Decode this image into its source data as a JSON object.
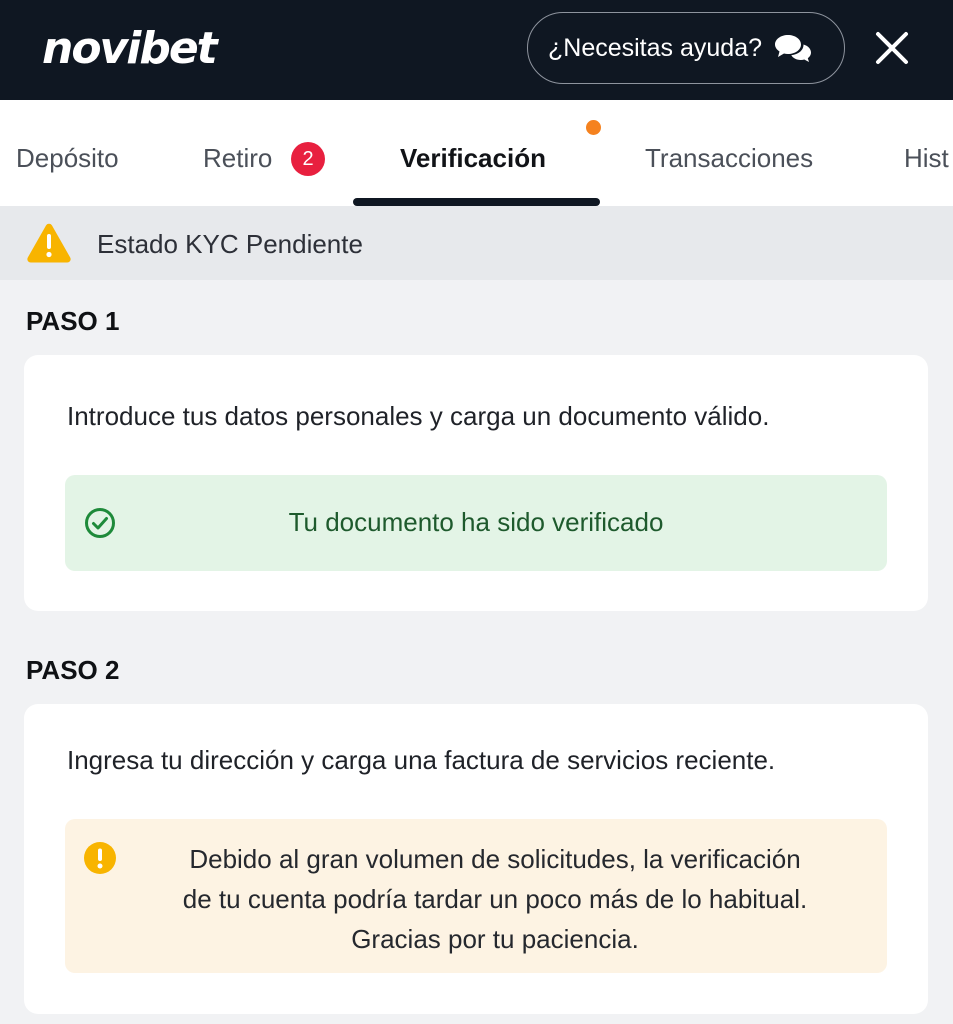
{
  "header": {
    "logo_text": "novibet",
    "help_label": "¿Necesitas ayuda?",
    "help_icon": "chat-bubbles-icon",
    "close_icon": "close-icon"
  },
  "tabs": [
    {
      "label": "Depósito"
    },
    {
      "label": "Retiro",
      "badge": "2"
    },
    {
      "label": "Verificación",
      "active": true
    },
    {
      "label": "Transacciones"
    },
    {
      "label": "Hist"
    }
  ],
  "kyc_status": {
    "icon": "warning-icon",
    "text": "Estado KYC Pendiente"
  },
  "steps": [
    {
      "title": "PASO 1",
      "description": "Introduce tus datos personales y carga un documento válido.",
      "status_icon": "check-circle-icon",
      "status_text": "Tu documento ha sido verificado"
    },
    {
      "title": "PASO 2",
      "description": "Ingresa tu dirección y carga una factura de servicios reciente.",
      "notice_icon": "exclamation-circle-icon",
      "notice_lines": [
        "Debido al gran volumen de solicitudes, la verificación",
        "de tu cuenta podría tardar un poco más de lo habitual.",
        "Gracias por tu paciencia."
      ]
    }
  ],
  "colors": {
    "header_bg": "#0f1722",
    "badge_red": "#e8203f",
    "dot_orange": "#f5821f",
    "warning_yellow": "#f8b400",
    "success_green": "#1e8a3a",
    "success_bg": "#e3f4e6",
    "notice_bg": "#fdf3e3"
  }
}
